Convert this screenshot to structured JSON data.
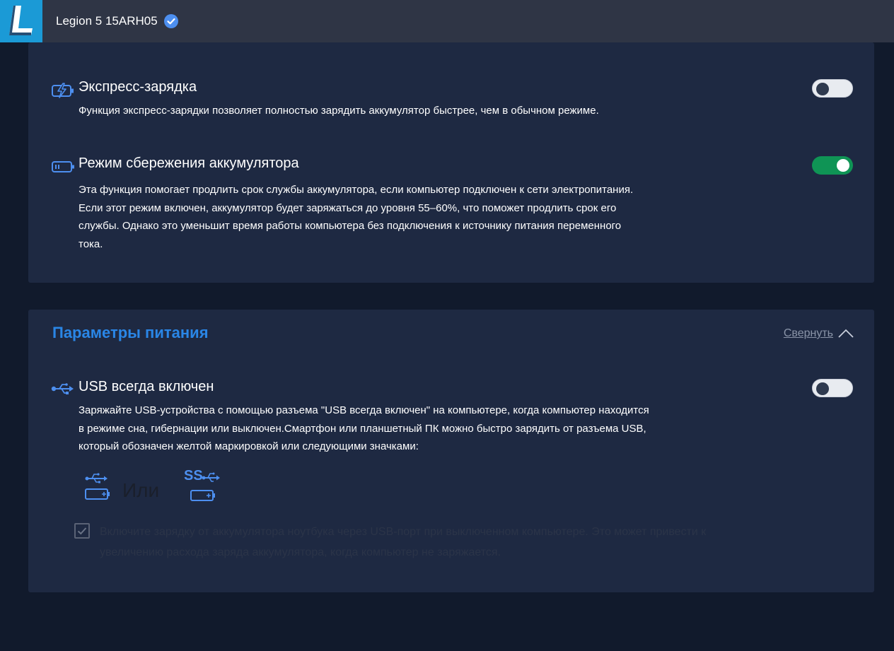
{
  "header": {
    "logo_letter": "L",
    "device_name": "Legion 5 15ARH05",
    "verified_icon": "check-badge-icon"
  },
  "colors": {
    "accent_blue": "#2a86e6",
    "toggle_on": "#0f9455",
    "card_bg": "#1e2942",
    "page_bg": "#111a2c"
  },
  "battery_card": {
    "rapid_charge": {
      "icon": "rapid-charge-icon",
      "title": "Экспресс-зарядка",
      "desc": "Функция экспресс-зарядки позволяет полностью зарядить аккумулятор быстрее, чем в обычном режиме.",
      "enabled": false
    },
    "conservation": {
      "icon": "battery-conservation-icon",
      "title": "Режим сбережения аккумулятора",
      "desc_lines": [
        "Эта функция помогает продлить срок службы аккумулятора, если компьютер подключен к сети электропитания.",
        "Если этот режим включен, аккумулятор будет заряжаться до уровня 55–60%, что поможет продлить срок его",
        "службы. Однако это уменьшит время работы компьютера без подключения к источнику питания переменного",
        "тока."
      ],
      "enabled": true
    }
  },
  "power_card": {
    "title": "Параметры питания",
    "collapse_label": "Свернуть",
    "usb_always_on": {
      "icon": "usb-icon",
      "title": "USB всегда включен",
      "desc_lines": [
        "Заряжайте USB-устройства с помощью разъема \"USB всегда включен\" на компьютере, когда компьютер находится",
        "в режиме сна, гибернации или выключен.Смартфон или планшетный ПК можно быстро зарядить от разъема USB,",
        "который обозначен желтой маркировкой или следующими значками:"
      ],
      "enabled": false,
      "or_text": "Или",
      "ss_label": "SS"
    },
    "battery_usb_checkbox": {
      "checked": true,
      "label_lines": [
        "Включите зарядку от аккумулятора ноутбука через USB-порт при выключенном компьютере. Это может привести к",
        "увеличению расхода заряда аккумулятора, когда компьютер не заряжается."
      ]
    }
  }
}
